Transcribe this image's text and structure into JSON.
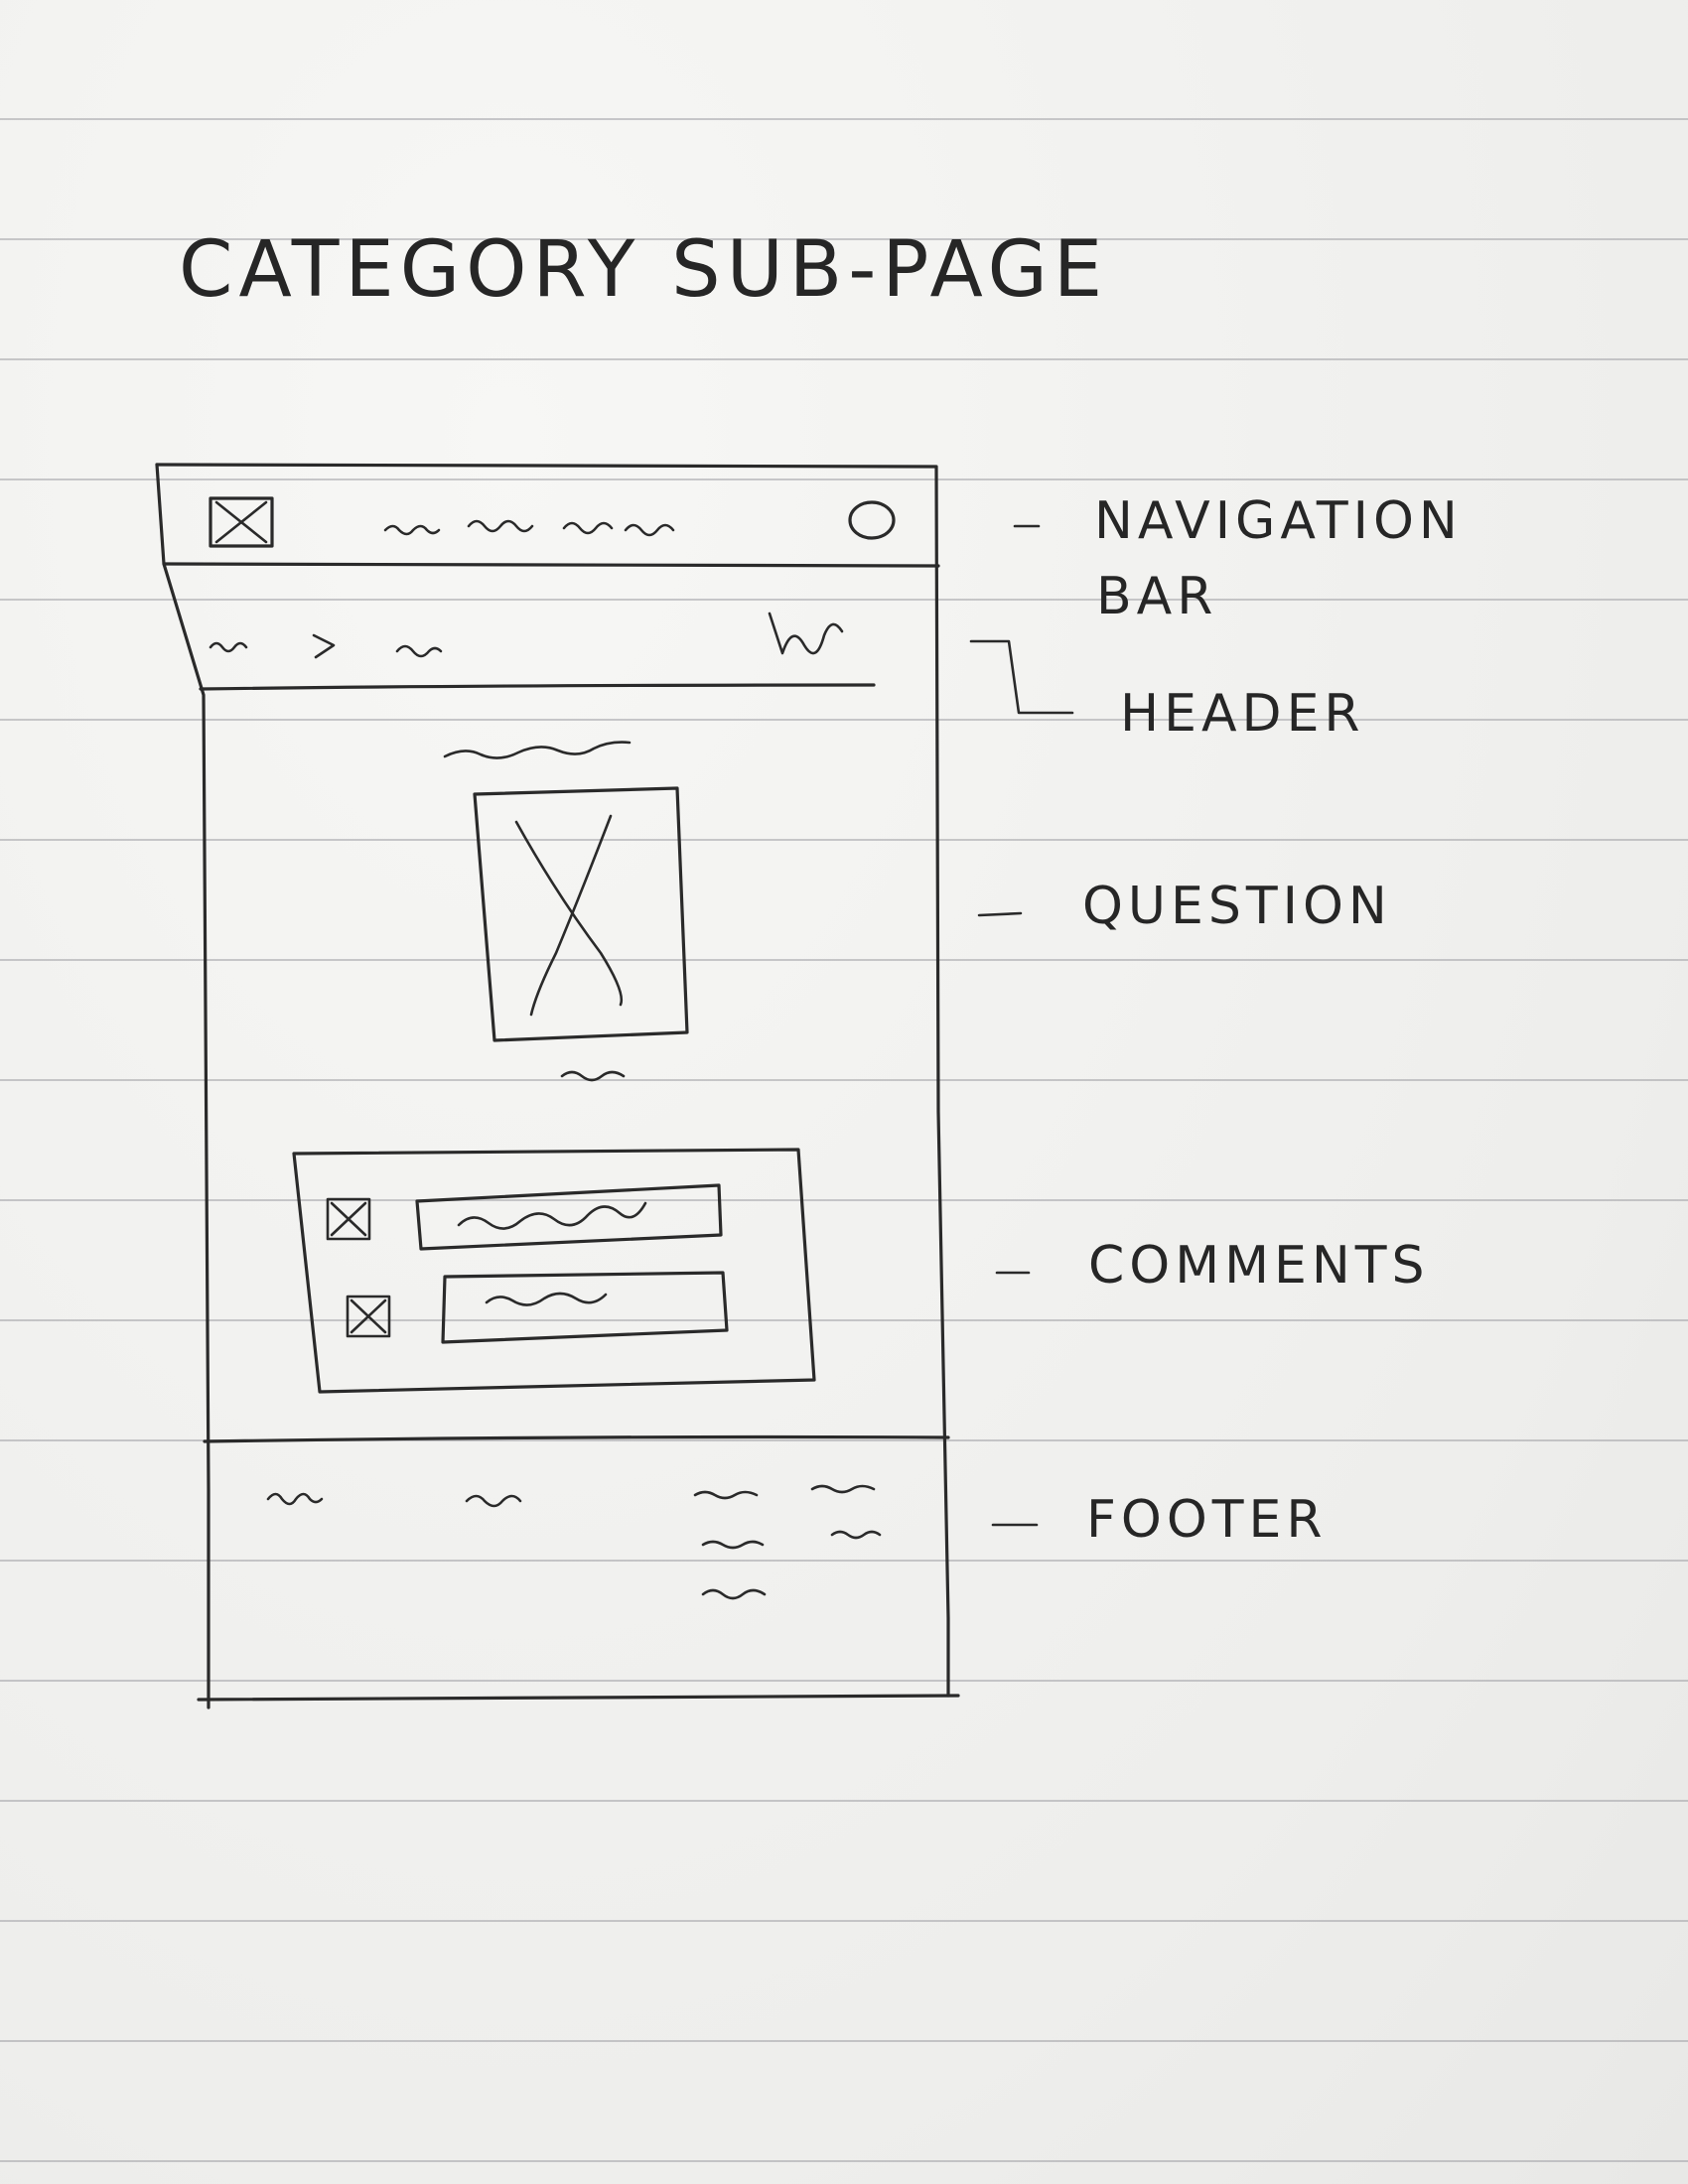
{
  "title": "CATEGORY SUB-PAGE",
  "sections": {
    "navigation": "NAVIGATION BAR",
    "navigation_line1": "NAVIGATION",
    "navigation_line2": "BAR",
    "header": "HEADER",
    "question": "QUESTION",
    "comments": "COMMENTS",
    "footer": "FOOTER"
  },
  "icons": {
    "nav_logo": "image-placeholder-icon",
    "nav_search": "circle-icon",
    "question_image": "image-placeholder-icon",
    "comment_avatar_1": "image-placeholder-icon",
    "comment_avatar_2": "image-placeholder-icon"
  },
  "colors": {
    "ink": "#2a2a2a",
    "paper": "#f4f4f2",
    "rule_lines": "#a0a0a5"
  }
}
